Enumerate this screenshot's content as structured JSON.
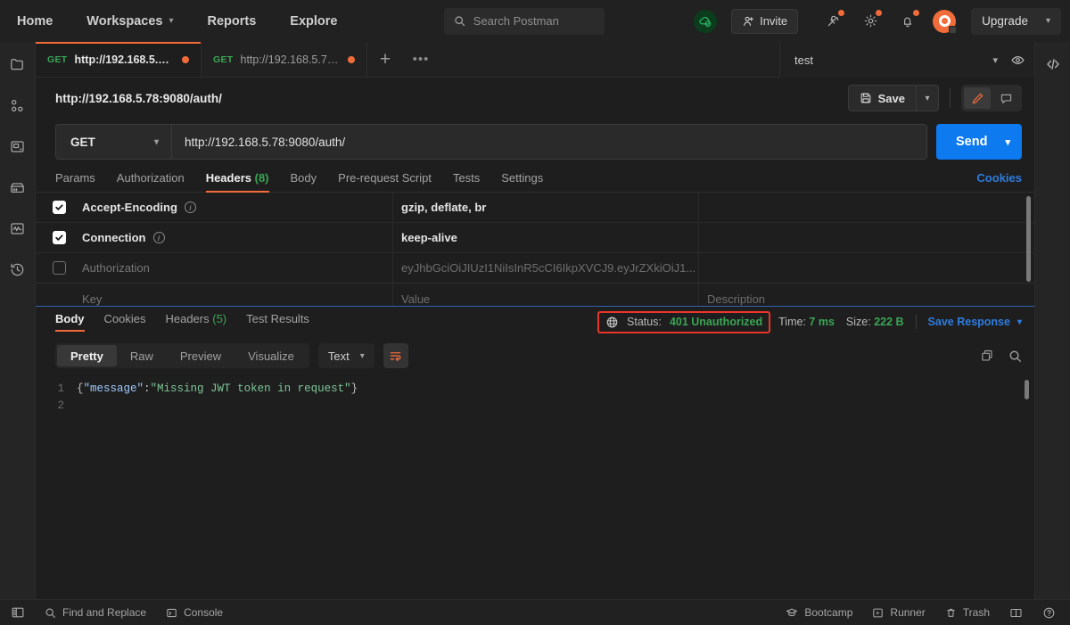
{
  "topnav": {
    "items": [
      {
        "label": "Home",
        "caret": false
      },
      {
        "label": "Workspaces",
        "caret": true
      },
      {
        "label": "Reports",
        "caret": false
      },
      {
        "label": "Explore",
        "caret": false
      }
    ],
    "search_placeholder": "Search Postman",
    "invite_label": "Invite",
    "upgrade_label": "Upgrade"
  },
  "tabs": [
    {
      "method": "GET",
      "title": "http://192.168.5.78...",
      "unsaved": true,
      "active": true
    },
    {
      "method": "GET",
      "title": "http://192.168.5.78...",
      "unsaved": true,
      "active": false
    }
  ],
  "environment": {
    "selected": "test"
  },
  "request": {
    "title": "http://192.168.5.78:9080/auth/",
    "save_label": "Save",
    "method": "GET",
    "url": "http://192.168.5.78:9080/auth/",
    "send_label": "Send",
    "tabs": [
      {
        "label": "Params",
        "count": "",
        "active": false
      },
      {
        "label": "Authorization",
        "count": "",
        "active": false
      },
      {
        "label": "Headers",
        "count": "(8)",
        "active": true
      },
      {
        "label": "Body",
        "count": "",
        "active": false
      },
      {
        "label": "Pre-request Script",
        "count": "",
        "active": false
      },
      {
        "label": "Tests",
        "count": "",
        "active": false
      },
      {
        "label": "Settings",
        "count": "",
        "active": false
      }
    ],
    "cookies_label": "Cookies"
  },
  "headers_table": {
    "columns": {
      "key": "Key",
      "value": "Value",
      "description": "Description"
    },
    "rows": [
      {
        "checked": true,
        "key": "Accept-Encoding",
        "info": true,
        "value": "gzip, deflate, br",
        "description": "",
        "muted": false
      },
      {
        "checked": true,
        "key": "Connection",
        "info": true,
        "value": "keep-alive",
        "description": "",
        "muted": false
      },
      {
        "checked": false,
        "key": "Authorization",
        "info": false,
        "value": "eyJhbGciOiJIUzI1NiIsInR5cCI6IkpXVCJ9.eyJrZXkiOiJ1...",
        "description": "",
        "muted": true
      }
    ],
    "placeholder_row": {
      "key": "Key",
      "value": "Value",
      "description": "Description"
    }
  },
  "response": {
    "tabs": [
      {
        "label": "Body",
        "count": "",
        "active": true
      },
      {
        "label": "Cookies",
        "count": "",
        "active": false
      },
      {
        "label": "Headers",
        "count": "(5)",
        "active": false
      },
      {
        "label": "Test Results",
        "count": "",
        "active": false
      }
    ],
    "status_label": "Status:",
    "status_value": "401 Unauthorized",
    "time_label": "Time:",
    "time_value": "7 ms",
    "size_label": "Size:",
    "size_value": "222 B",
    "save_response_label": "Save Response",
    "view_modes": [
      {
        "label": "Pretty",
        "active": true
      },
      {
        "label": "Raw",
        "active": false
      },
      {
        "label": "Preview",
        "active": false
      },
      {
        "label": "Visualize",
        "active": false
      }
    ],
    "format": "Text",
    "body_lines": [
      {
        "num": "1",
        "content": "{\"message\":\"Missing JWT token in request\"}"
      },
      {
        "num": "2",
        "content": ""
      }
    ],
    "body_parts": {
      "open_brace": "{",
      "key": "\"message\"",
      "colon": ":",
      "value": "\"Missing JWT token in request\"",
      "close_brace": "}"
    }
  },
  "bottombar": {
    "left": [
      {
        "label": "Find and Replace",
        "icon": "search-icon"
      },
      {
        "label": "Console",
        "icon": "console-icon"
      }
    ],
    "right": [
      {
        "label": "Bootcamp",
        "icon": "bootcamp-icon"
      },
      {
        "label": "Runner",
        "icon": "runner-icon"
      },
      {
        "label": "Trash",
        "icon": "trash-icon"
      }
    ]
  },
  "colors": {
    "accent": "#f26b3a",
    "send": "#0e7af0",
    "success": "#3aa655",
    "link": "#2e7de0",
    "annotation": "#e8362b"
  }
}
